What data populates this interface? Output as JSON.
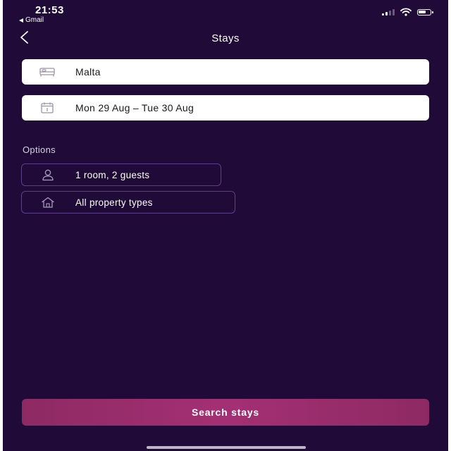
{
  "status_bar": {
    "time": "21:53",
    "back_app": "Gmail",
    "icons": [
      "signal-icon",
      "wifi-icon",
      "battery-icon"
    ]
  },
  "nav": {
    "back_icon": "chevron-left-icon",
    "title": "Stays"
  },
  "search": {
    "location": {
      "icon": "bed-icon",
      "value": "Malta"
    },
    "dates": {
      "icon": "calendar-icon",
      "value": "Mon 29 Aug – Tue 30 Aug"
    }
  },
  "options": {
    "heading": "Options",
    "guests": {
      "icon": "person-icon",
      "value": "1 room, 2 guests"
    },
    "property": {
      "icon": "house-icon",
      "value": "All property types"
    }
  },
  "actions": {
    "search_label": "Search stays"
  },
  "colors": {
    "background": "#1f0a38",
    "field": "#ffffff",
    "chip_border": "#5e3f8a",
    "primary_button": "#a33074"
  }
}
